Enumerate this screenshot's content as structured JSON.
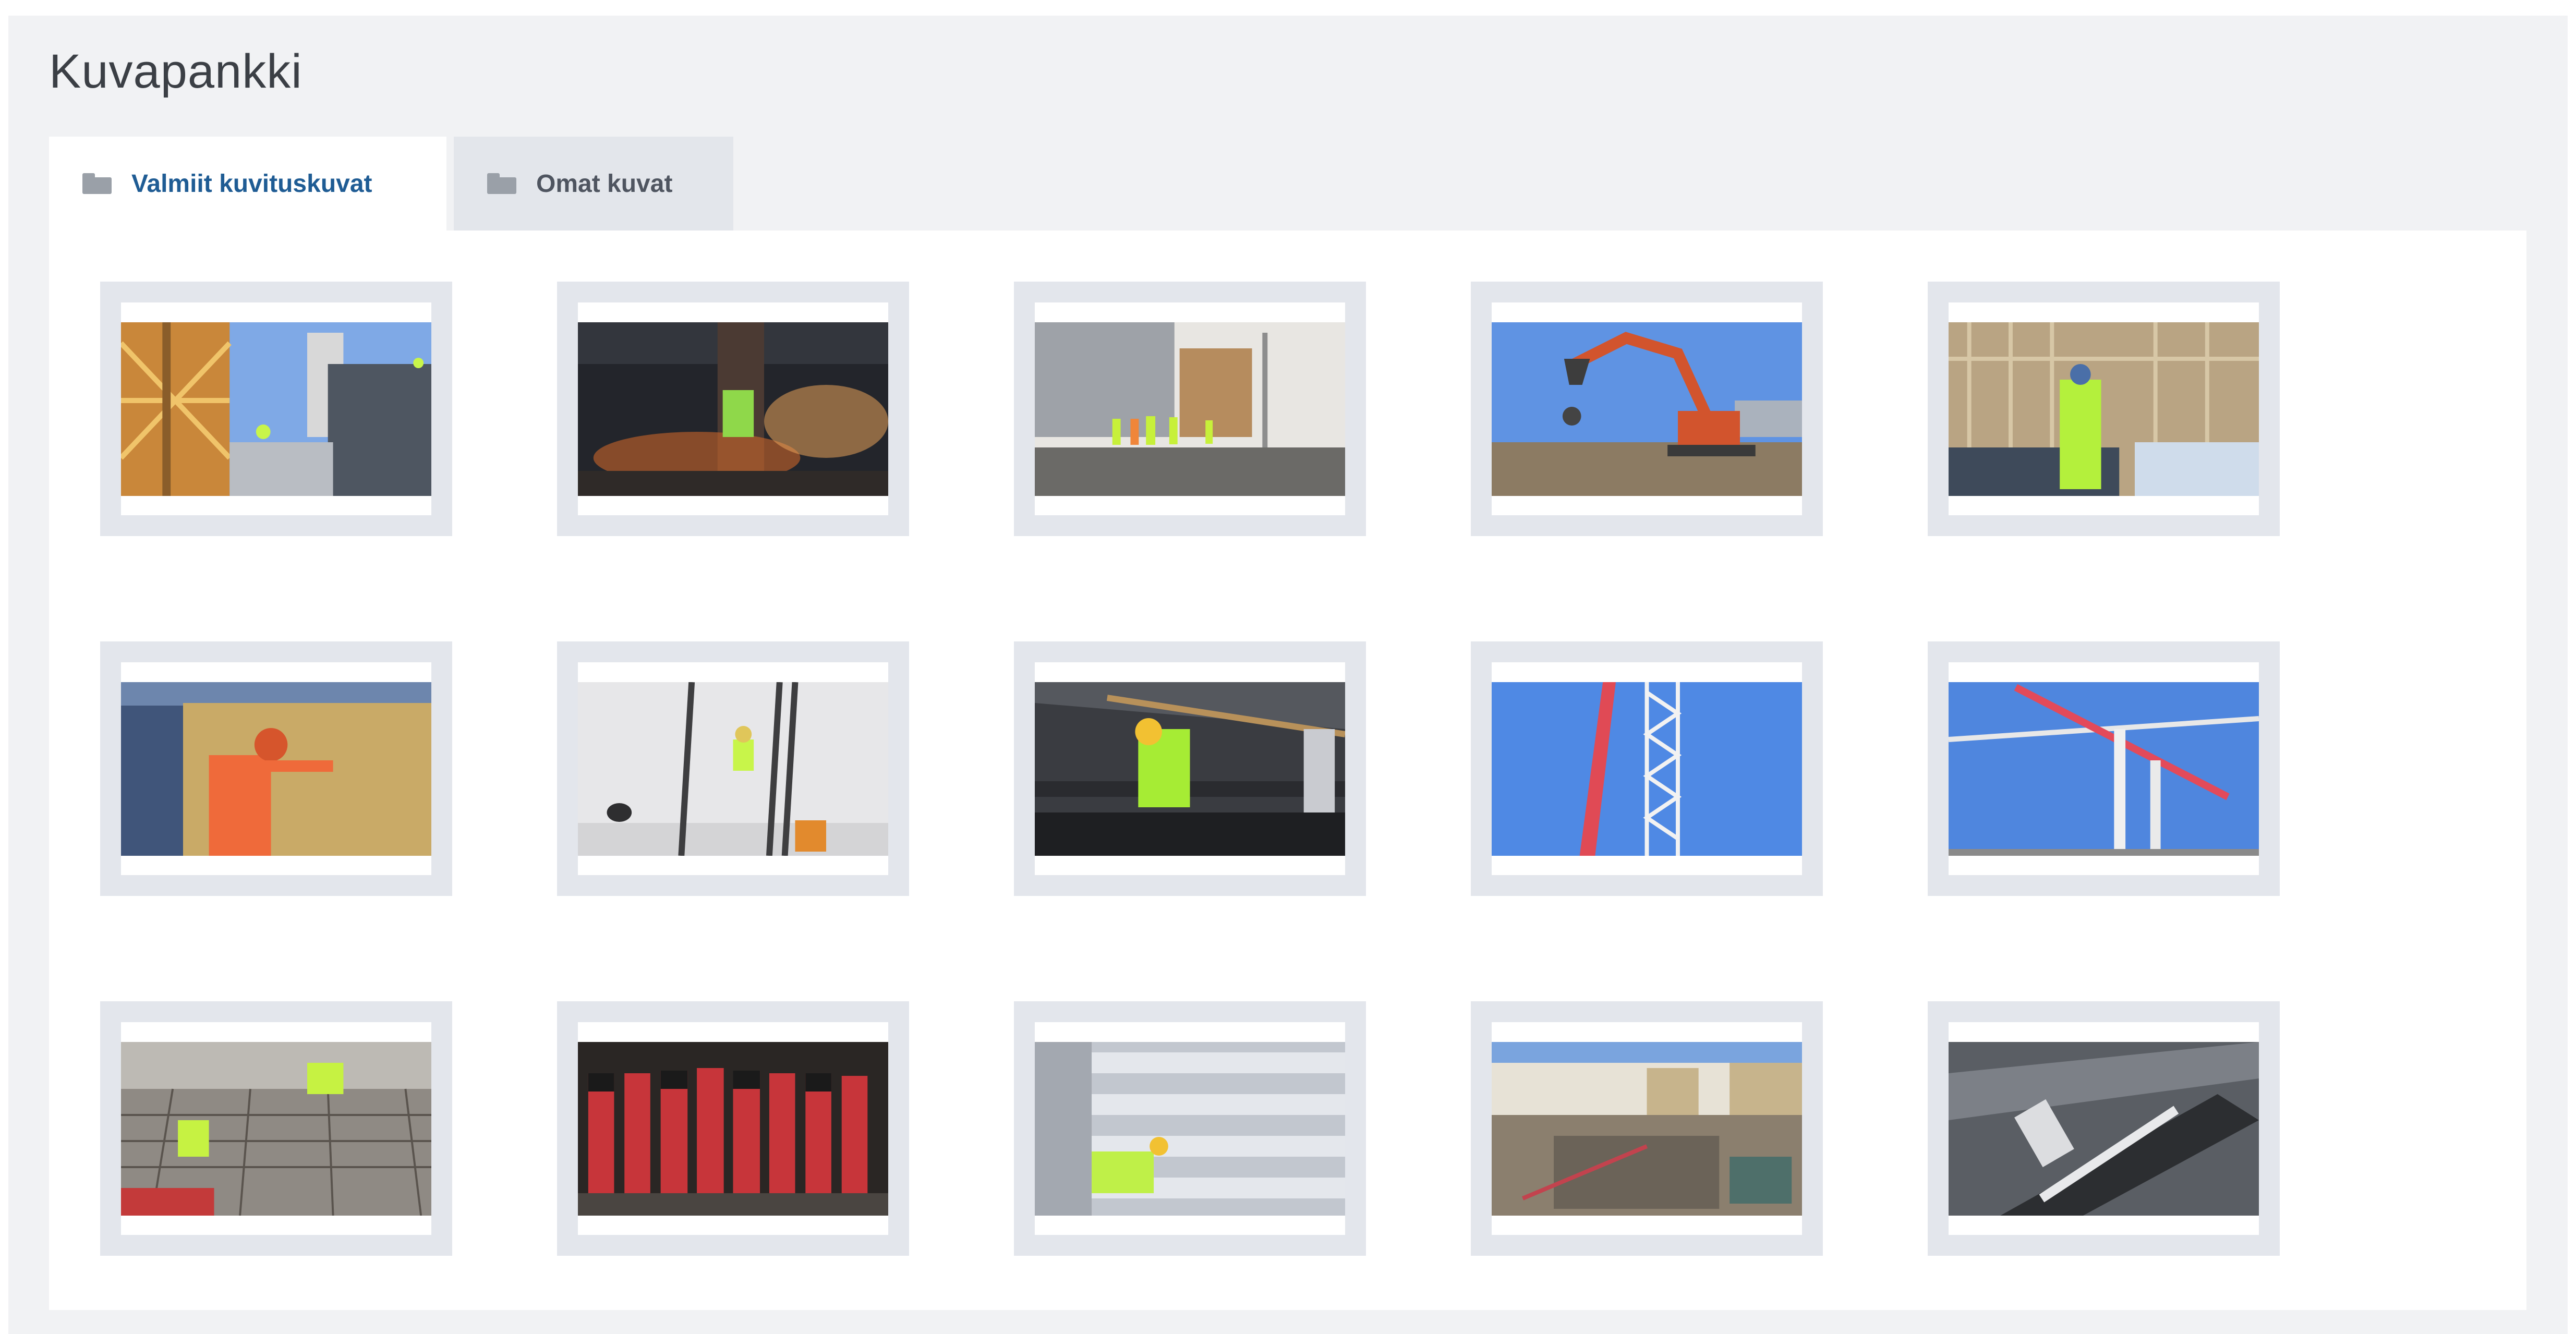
{
  "title": "Kuvapankki",
  "tabs": [
    {
      "label": "Valmiit kuvituskuvat",
      "icon": "folder-icon",
      "active": true
    },
    {
      "label": "Omat kuvat",
      "icon": "folder-icon",
      "active": false
    }
  ],
  "colors": {
    "accent": "#1f5c94",
    "panel_bg": "#f1f2f4",
    "thumb_frame": "#e3e6ec",
    "inactive_tab": "#e3e6eb"
  },
  "images": [
    {
      "subject": "crane-and-rooftop-workers"
    },
    {
      "subject": "grinding-sparks"
    },
    {
      "subject": "workers-walking-site"
    },
    {
      "subject": "orange-excavator"
    },
    {
      "subject": "worker-at-scaffold"
    },
    {
      "subject": "worker-installing-board"
    },
    {
      "subject": "worker-on-ladder"
    },
    {
      "subject": "worker-cutting-stairs"
    },
    {
      "subject": "red-crane-tower"
    },
    {
      "subject": "tower-cranes-sky"
    },
    {
      "subject": "rebar-workers"
    },
    {
      "subject": "red-tool-cartridges"
    },
    {
      "subject": "concrete-beams-worker"
    },
    {
      "subject": "city-construction-site"
    },
    {
      "subject": "trowel-on-concrete"
    }
  ]
}
